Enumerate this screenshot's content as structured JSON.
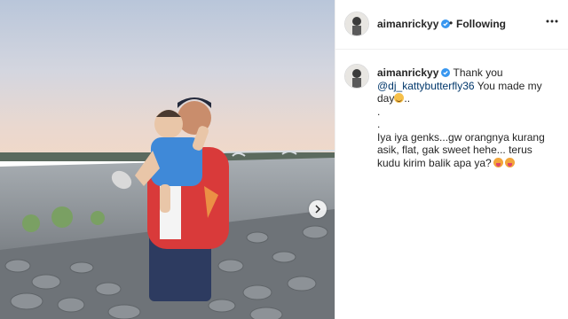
{
  "post": {
    "username": "aimanrickyy",
    "separator": "•",
    "follow_status": "Following",
    "caption": {
      "line1_text": "Thank you",
      "mention": "@dj_kattybutterfly36",
      "line2_text": "You made my day",
      "after_emoji": "..",
      "dot1": ".",
      "dot2": ".",
      "paragraph": "Iya iya genks...gw orangnya kurang asik, flat, gak sweet hehe... terus kudu kirim balik apa ya?"
    },
    "icons": {
      "verified": "verified-badge-icon",
      "more": "more-options-icon",
      "next": "chevron-right-icon",
      "emoji_smile": "smiling-face-icon",
      "emoji_tongue": "tongue-face-icon"
    },
    "colors": {
      "verified": "#3897f0",
      "text": "#262626",
      "mention": "#00376b",
      "border": "#efefef"
    }
  }
}
